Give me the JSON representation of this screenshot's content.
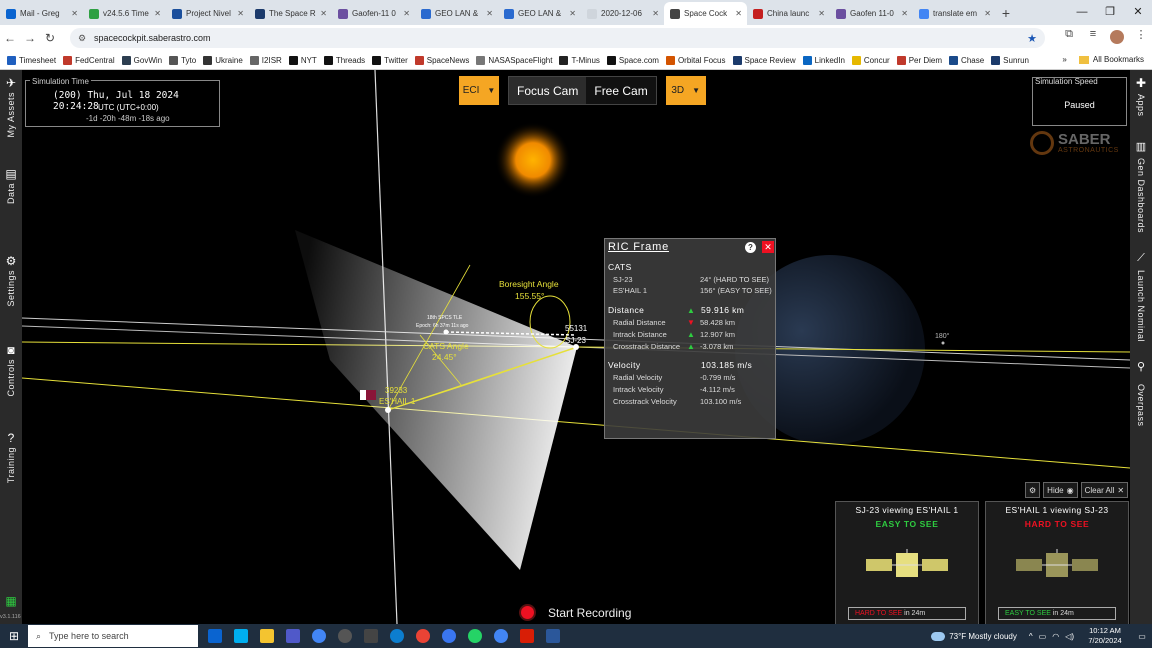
{
  "browser": {
    "tabs": [
      {
        "label": "Mail - Greg",
        "icon": "mail-icon",
        "color": "#0a64d0"
      },
      {
        "label": "v24.5.6 Time",
        "icon": "check-icon",
        "color": "#2ea043"
      },
      {
        "label": "Project Nivel",
        "icon": "doc-icon",
        "color": "#1b4f9c"
      },
      {
        "label": "The Space R",
        "icon": "review-icon",
        "color": "#1b3a6b"
      },
      {
        "label": "Gaofen-11 0",
        "icon": "globe-icon",
        "color": "#6b4fa0"
      },
      {
        "label": "GEO LAN &",
        "icon": "star-icon",
        "color": "#2a6acf"
      },
      {
        "label": "GEO LAN &",
        "icon": "star-icon",
        "color": "#2a6acf"
      },
      {
        "label": "2020-12-06",
        "icon": "blank-icon",
        "color": "#cfd5dc"
      },
      {
        "label": "Space Cock",
        "icon": "satellite-icon",
        "color": "#444"
      },
      {
        "label": "China launc",
        "icon": "cnn-icon",
        "color": "#c41f1f"
      },
      {
        "label": "Gaofen 11-0",
        "icon": "globe-icon",
        "color": "#6b4fa0"
      },
      {
        "label": "translate em",
        "icon": "google-icon",
        "color": "#4285f4"
      }
    ],
    "active_tab": 8,
    "new_tab": "+",
    "window_controls": [
      "—",
      "❐",
      "✕"
    ],
    "url": "spacecockpit.saberastro.com",
    "bookmarks": [
      {
        "label": "Timesheet",
        "color": "#1f5fbf"
      },
      {
        "label": "FedCentral",
        "color": "#c0392b"
      },
      {
        "label": "GovWin",
        "color": "#2c3e50"
      },
      {
        "label": "Tyto",
        "color": "#555"
      },
      {
        "label": "Ukraine",
        "color": "#333"
      },
      {
        "label": "I2ISR",
        "color": "#666"
      },
      {
        "label": "NYT",
        "color": "#111"
      },
      {
        "label": "Threads",
        "color": "#111"
      },
      {
        "label": "Twitter",
        "color": "#111"
      },
      {
        "label": "SpaceNews",
        "color": "#c0392b"
      },
      {
        "label": "NASASpaceFlight",
        "color": "#777"
      },
      {
        "label": "T-Minus",
        "color": "#222"
      },
      {
        "label": "Space.com",
        "color": "#111"
      },
      {
        "label": "Orbital Focus",
        "color": "#d35400"
      },
      {
        "label": "Space Review",
        "color": "#1b3a6b"
      },
      {
        "label": "LinkedIn",
        "color": "#0a66c2"
      },
      {
        "label": "Concur",
        "color": "#e6b800"
      },
      {
        "label": "Per Diem",
        "color": "#c0392b"
      },
      {
        "label": "Chase",
        "color": "#1a4a8a"
      },
      {
        "label": "Sunrun",
        "color": "#1b3a6b"
      }
    ],
    "all_bookmarks": "All Bookmarks",
    "more_bookmarks": "»"
  },
  "left_sidebar": {
    "my_assets": "My Assets",
    "data": "Data",
    "settings": "Settings",
    "controls": "Controls",
    "training": "Training"
  },
  "right_sidebar": {
    "apps": "Apps",
    "gen_dashboards": "Gen Dashboards",
    "launch_nominal": "Launch Nominal",
    "overpass": "Overpass"
  },
  "sim_time": {
    "label": "Simulation Time",
    "line1": "(200)  Thu, Jul 18 2024 20:24:28",
    "line2": "UTC (UTC+0:00)",
    "line3": "-1d -20h -48m -18s ago"
  },
  "camera": {
    "frame": "ECI",
    "focus_cam": "Focus Cam",
    "free_cam": "Free Cam",
    "view": "3D"
  },
  "sim_speed": {
    "label": "Simulation Speed",
    "value": "Paused"
  },
  "logo": {
    "name": "SABER",
    "sub": "ASTRONAUTICS"
  },
  "scene_labels": {
    "boresight_title": "Boresight Angle",
    "boresight_value": "155.55°",
    "cats_title": "CATS Angle",
    "cats_value": "24.45°",
    "tle_line1": "18th SPCS TLE",
    "tle_line2": "Epoch: 6h 37m 11s ago",
    "sat1_id": "55131",
    "sat1_name": "SJ-23",
    "sat2_id": "39233",
    "sat2_name": "ES'HAIL 1",
    "longitude": "180°"
  },
  "ric": {
    "title": "RIC Frame",
    "help": "?",
    "close": "✕",
    "cats_header": "CATS",
    "cats_rows": [
      {
        "name": "SJ-23",
        "value": "24° (HARD TO SEE)"
      },
      {
        "name": "ES'HAIL 1",
        "value": "156° (EASY TO SEE)"
      }
    ],
    "distance_header": "Distance",
    "distance_value": "59.916 km",
    "distance_dir": "up",
    "distance_rows": [
      {
        "name": "Radial Distance",
        "value": "58.428 km",
        "dir": "down"
      },
      {
        "name": "Intrack Distance",
        "value": "12.907 km",
        "dir": "up"
      },
      {
        "name": "Crosstrack Distance",
        "value": "-3.078 km",
        "dir": "up"
      }
    ],
    "velocity_header": "Velocity",
    "velocity_value": "103.185 m/s",
    "velocity_rows": [
      {
        "name": "Radial Velocity",
        "value": "-0.799 m/s"
      },
      {
        "name": "Intrack Velocity",
        "value": "-4.112 m/s"
      },
      {
        "name": "Crosstrack Velocity",
        "value": "103.100 m/s"
      }
    ]
  },
  "card_controls": {
    "hide": "Hide",
    "clear_all": "Clear All",
    "settings_icon": "gear-icon"
  },
  "viewing_cards": [
    {
      "header": "SJ-23 viewing ES'HAIL 1",
      "status": "EASY TO SEE",
      "status_color": "#2ecc40",
      "footer_status": "HARD TO SEE",
      "footer_color": "#e12",
      "footer_time": "in 24m"
    },
    {
      "header": "ES'HAIL 1 viewing SJ-23",
      "status": "HARD TO SEE",
      "status_color": "#e12",
      "footer_status": "EASY TO SEE",
      "footer_color": "#2ecc40",
      "footer_time": "in 24m"
    }
  ],
  "recording": {
    "label": "Start Recording"
  },
  "version": "v3.1.116",
  "taskbar": {
    "search_placeholder": "Type here to search",
    "weather": "73°F  Mostly cloudy",
    "time": "10:12 AM",
    "date": "7/20/2024",
    "apps": [
      "outlook-icon",
      "skype-icon",
      "files-icon",
      "teams-icon",
      "chrome-icon",
      "firefox-icon",
      "calculator-icon",
      "edge-icon",
      "chrome-alt-icon",
      "signal-icon",
      "whatsapp-icon",
      "chrome-profile-icon",
      "acrobat-icon",
      "word-icon"
    ],
    "app_colors": [
      "#0a64d0",
      "#00aff0",
      "#f4c430",
      "#5059c9",
      "#4285f4",
      "#555",
      "#444",
      "#0c7ecf",
      "#ea4335",
      "#3a76f0",
      "#25d366",
      "#4285f4",
      "#d81e06",
      "#2b579a"
    ]
  },
  "colors": {
    "accent": "#f5a623",
    "orbit_yellow": "#e6e03a",
    "sun": "#f08a00",
    "panel": "#3c3c3c"
  }
}
